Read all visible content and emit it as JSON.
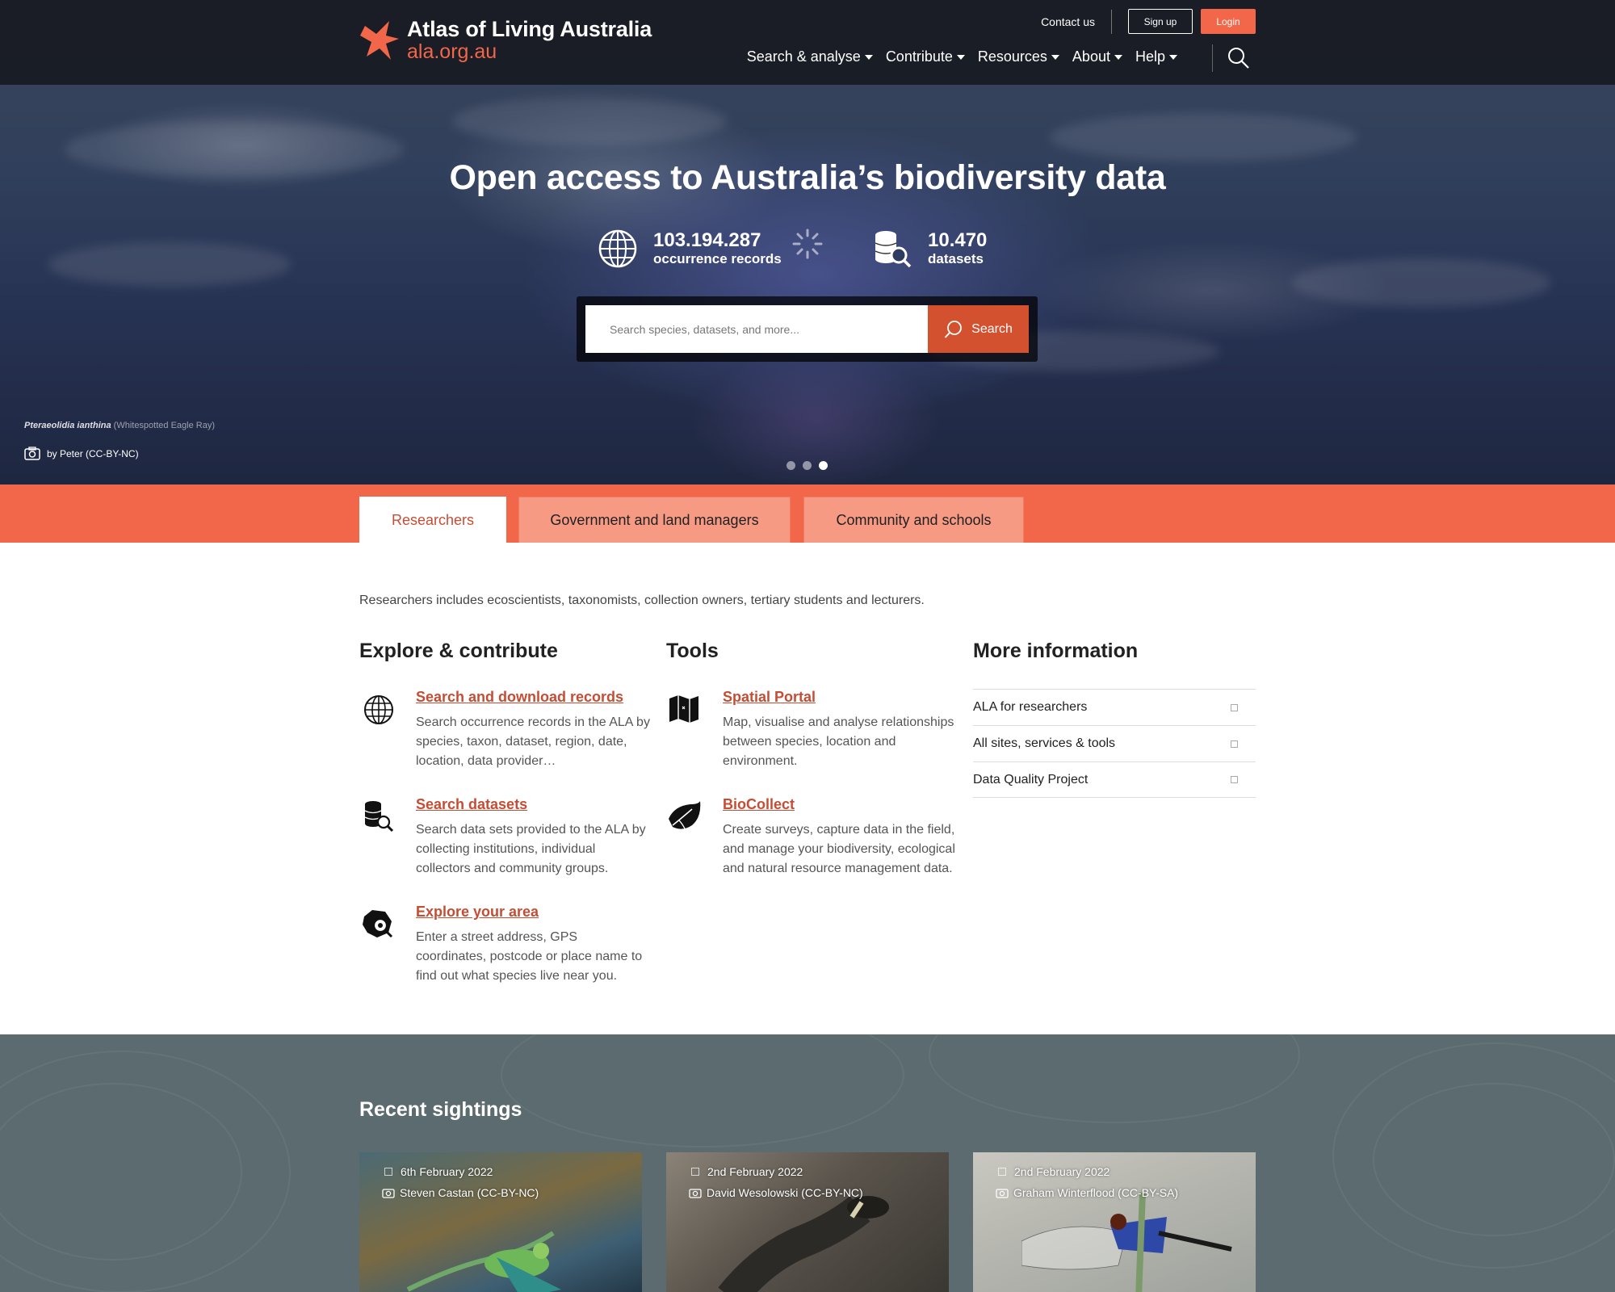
{
  "site": {
    "title": "Atlas of Living Australia",
    "url": "ala.org.au"
  },
  "top_links": {
    "contact": "Contact us",
    "signup": "Sign up",
    "login": "Login"
  },
  "nav": [
    {
      "label": "Search & analyse"
    },
    {
      "label": "Contribute"
    },
    {
      "label": "Resources"
    },
    {
      "label": "About"
    },
    {
      "label": "Help"
    }
  ],
  "hero": {
    "title": "Open access to Australia’s biodiversity data",
    "stats": [
      {
        "value": "103.194.287",
        "label": "occurrence records",
        "icon": "globe-icon"
      },
      {
        "value": "10.470",
        "label": "datasets",
        "icon": "database-search-icon"
      }
    ],
    "search": {
      "placeholder": "Search species, datasets, and more...",
      "button": "Search"
    },
    "caption": {
      "scientific_name": "Pteraeolidia ianthina",
      "common_name": "(Whitespotted Eagle Ray)",
      "credit": "by Peter (CC-BY-NC)"
    },
    "carousel": {
      "slides": 3,
      "active": 3
    }
  },
  "audience_tabs": [
    {
      "label": "Researchers",
      "active": true
    },
    {
      "label": "Government and land managers",
      "active": false
    },
    {
      "label": "Community and schools",
      "active": false
    }
  ],
  "main": {
    "intro": "Researchers includes ecoscientists, taxonomists, collection owners, tertiary students and lecturers.",
    "explore": {
      "heading": "Explore & contribute",
      "items": [
        {
          "title": "Search and download records",
          "desc": "Search occurrence records in the ALA by species, taxon, dataset, region, date, location, data provider…",
          "icon": "globe-icon"
        },
        {
          "title": "Search datasets",
          "desc": "Search data sets provided to the ALA by collecting institutions, individual collectors and community groups.",
          "icon": "database-search-icon"
        },
        {
          "title": "Explore your area",
          "desc": "Enter a street address, GPS coordinates, postcode or place name to find out what species live near you.",
          "icon": "area-search-icon"
        }
      ]
    },
    "tools": {
      "heading": "Tools",
      "items": [
        {
          "title": "Spatial Portal",
          "desc": "Map, visualise and analyse relationships between species, location and environment.",
          "icon": "map-icon"
        },
        {
          "title": "BioCollect",
          "desc": "Create surveys, capture data in the field, and manage your biodiversity, ecological and natural resource management data.",
          "icon": "leaf-icon"
        }
      ]
    },
    "more": {
      "heading": "More information",
      "items": [
        {
          "label": "ALA for researchers"
        },
        {
          "label": "All sites, services & tools"
        },
        {
          "label": "Data Quality Project"
        }
      ]
    }
  },
  "recent_sightings": {
    "heading": "Recent sightings",
    "cards": [
      {
        "date": "6th February 2022",
        "credit": "Steven Castan (CC-BY-NC)"
      },
      {
        "date": "2nd February 2022",
        "credit": "David Wesolowski (CC-BY-NC)"
      },
      {
        "date": "2nd February 2022",
        "credit": "Graham Winterflood (CC-BY-SA)"
      }
    ]
  },
  "colors": {
    "brand": "#f26649",
    "link": "#c44d34",
    "dark_header": "#16181e",
    "sightings_bg": "#5c6b6f"
  }
}
